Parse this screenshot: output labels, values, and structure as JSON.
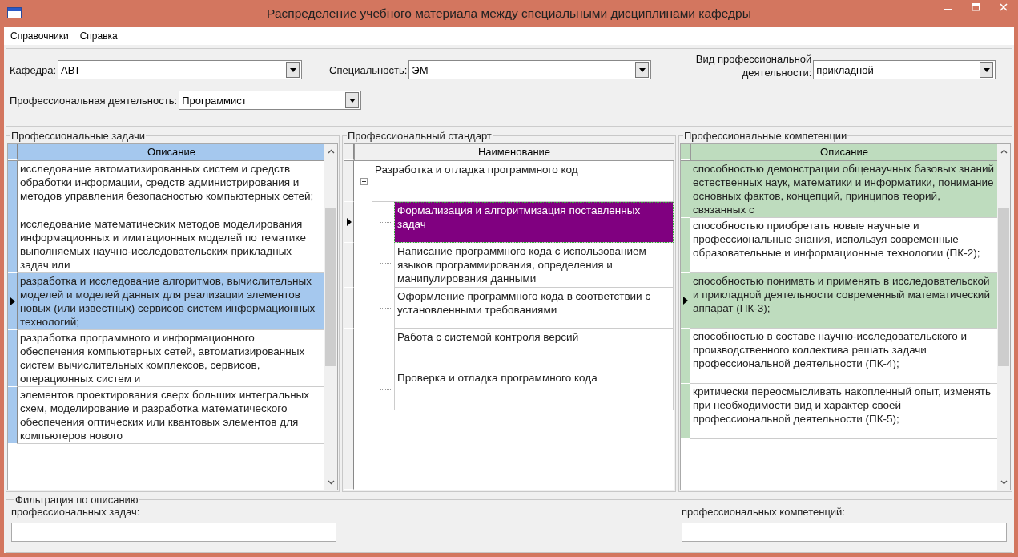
{
  "window": {
    "title": "Распределение учебного материала между специальными дисциплинами кафедры"
  },
  "menu": [
    "Справочники",
    "Справка"
  ],
  "selectors": [
    {
      "label": "Кафедра:",
      "value": "АВТ"
    },
    {
      "label": "Специальность:",
      "value": "ЭМ"
    },
    {
      "label": "Вид профессиональной деятельности:",
      "value": "прикладной"
    },
    {
      "label": "Профессиональная деятельность:",
      "value": "Программист"
    }
  ],
  "tasks": {
    "title": "Профессиональные задачи",
    "column": "Описание",
    "rows": [
      {
        "text": "исследование автоматизированных систем и средств обработки информации, средств администрирования и методов управления безопасностью компьютерных сетей;",
        "selected": false
      },
      {
        "text": "исследование математических методов моделирования информационных и имитационных моделей по тематике выполняемых научно-исследовательских прикладных задач или",
        "selected": false
      },
      {
        "text": "разработка и исследование алгоритмов, вычислительных моделей и моделей данных для реализации элементов новых (или известных) сервисов систем информационных технологий;",
        "selected": true
      },
      {
        "text": "разработка программного и информационного обеспечения компьютерных сетей, автоматизированных систем вычислительных комплексов, сервисов, операционных систем и",
        "selected": false
      },
      {
        "text": "элементов проектирования сверх больших интегральных схем, моделирование и разработка математического обеспечения оптических или квантовых элементов для компьютеров нового",
        "selected": false
      }
    ]
  },
  "standard": {
    "title": "Профессиональный стандарт",
    "column": "Наименование",
    "tree": [
      {
        "text": "Разработка и отладка программного код",
        "expanded": true,
        "selected": false,
        "children": [
          {
            "text": "Формализация и алгоритмизация поставленных задач",
            "selected": true
          },
          {
            "text": "Написание программного кода с использованием языков программирования, определения и манипулирования данными",
            "selected": false
          },
          {
            "text": "Оформление программного кода в соответствии с установленными требованиями",
            "selected": false
          },
          {
            "text": "Работа с системой контроля версий",
            "selected": false
          },
          {
            "text": "Проверка и отладка программного кода",
            "selected": false
          }
        ]
      }
    ]
  },
  "competencies": {
    "title": "Профессиональные компетенции",
    "column": "Описание",
    "rows": [
      {
        "text": "способностью демонстрации общенаучных базовых знаний естественных наук, математики и информатики, понимание основных фактов, концепций, принципов теорий, связанных с",
        "selected": false,
        "highlighted": true
      },
      {
        "text": "способностью приобретать новые научные и профессиональные знания, используя современные образовательные и информационные технологии (ПК-2);",
        "selected": false,
        "highlighted": false
      },
      {
        "text": "способностью понимать и применять в исследовательской и прикладной деятельности современный математический аппарат (ПК-3);",
        "selected": true,
        "highlighted": true
      },
      {
        "text": "способностью в составе научно-исследовательского и производственного коллектива решать задачи профессиональной деятельности (ПК-4);",
        "selected": false,
        "highlighted": false
      },
      {
        "text": "критически переосмысливать накопленный опыт, изменять при необходимости вид и характер своей профессиональной деятельности (ПК-5);",
        "selected": false,
        "highlighted": false
      }
    ]
  },
  "filter": {
    "title": "Фильтрация по описанию",
    "fields": [
      {
        "label": "профессиональных задач:"
      },
      {
        "label": "профессиональных компетенций:"
      }
    ]
  }
}
